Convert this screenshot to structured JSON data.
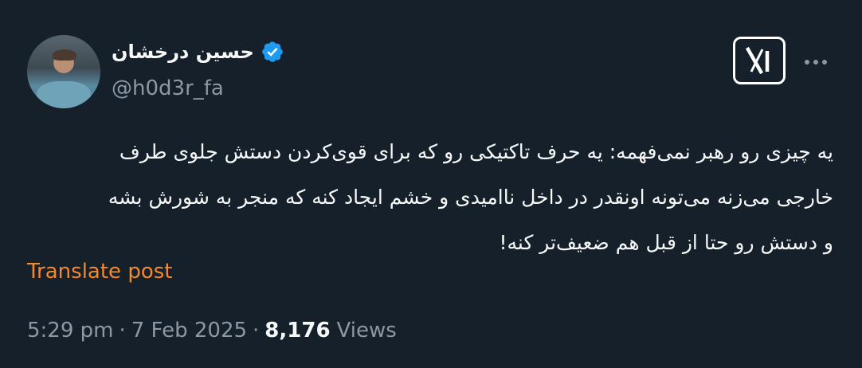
{
  "author": {
    "display_name": "حسین درخشان",
    "handle": "@h0d3r_fa",
    "verified": true,
    "avatar_icon": "user-avatar"
  },
  "header": {
    "logo_icon": "x-logo-icon",
    "more_icon": "more-options-icon"
  },
  "tweet": {
    "lines": [
      "یه چیزی رو رهبر نمی‌فهمه: یه حرف تاکتیکی رو که برای قوی‌کردن دستش جلوی طرف",
      "خارجی می‌زنه می‌تونه اونقدر در داخل ناامیدی و خشم ایجاد کنه که منجر به شورش بشه",
      "و دستش رو حتا از قبل هم ضعیف‌تر کنه!"
    ],
    "translate_label": "Translate post"
  },
  "meta": {
    "time": "5:29 pm",
    "separator": "·",
    "date": "7 Feb 2025",
    "views_count": "8,176",
    "views_label": "Views"
  },
  "colors": {
    "background": "#15202b",
    "text": "#f7f9f9",
    "muted": "#8b98a5",
    "translate": "#f4882a",
    "verified": "#1d9bf0"
  }
}
